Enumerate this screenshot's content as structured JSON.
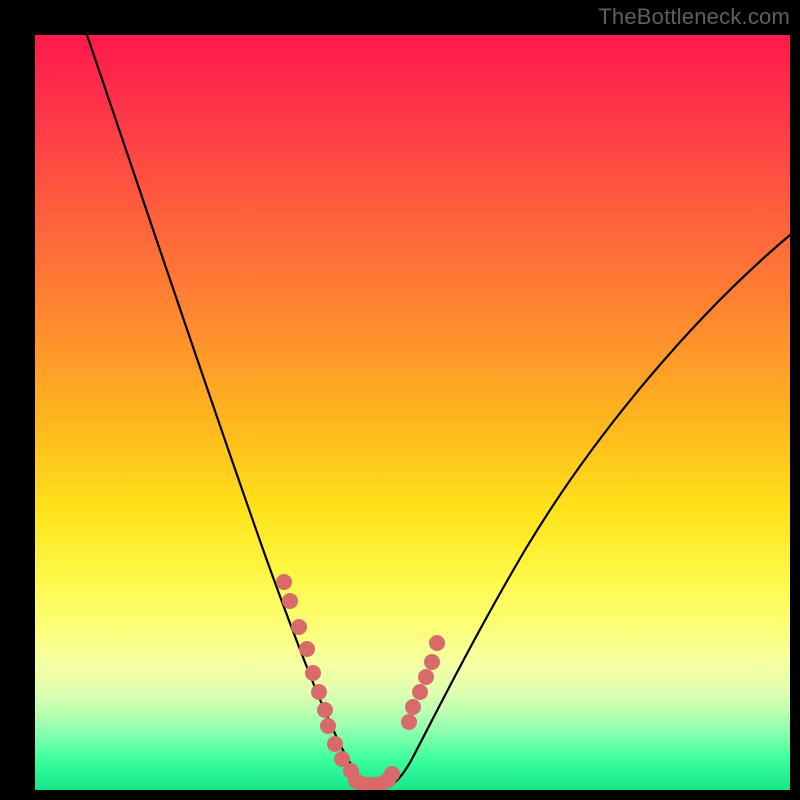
{
  "watermark": {
    "text": "TheBottleneck.com"
  },
  "colors": {
    "background": "#000000",
    "gradient_top": "#ff1a4b",
    "gradient_mid": "#ffe31a",
    "gradient_bottom": "#14e58c",
    "curve_stroke": "#000000",
    "marker_fill": "#d96a6a"
  },
  "chart_data": {
    "type": "line",
    "title": "",
    "xlabel": "",
    "ylabel": "",
    "xlim": [
      0,
      100
    ],
    "ylim": [
      0,
      100
    ],
    "grid": false,
    "legend": false,
    "annotations": [
      "TheBottleneck.com"
    ],
    "notes": "Bottleneck-style curve. y ≈ percent bottleneck (0 at minimum). x is an unlabeled independent axis. Curve read from pixels; values are approximate.",
    "series": [
      {
        "name": "curve",
        "x": [
          7,
          11,
          15,
          19,
          23,
          27,
          31,
          33,
          35,
          37,
          38,
          39,
          40,
          41,
          42,
          43,
          44,
          45,
          46,
          47,
          48,
          50,
          53,
          57,
          62,
          68,
          75,
          82,
          90,
          98
        ],
        "y": [
          100,
          89,
          78,
          67,
          56,
          45,
          34,
          28,
          22,
          16,
          12,
          9,
          6,
          3,
          1,
          0,
          0,
          0,
          1,
          3,
          6,
          11,
          18,
          27,
          37,
          47,
          56,
          63,
          69,
          74
        ]
      },
      {
        "name": "markers-left",
        "x": [
          33.0,
          33.8,
          35.0,
          36.0,
          36.8,
          37.6,
          38.4,
          38.8,
          39.8,
          40.6,
          41.8
        ],
        "y": [
          27.5,
          25.0,
          21.5,
          18.5,
          15.5,
          13.0,
          10.5,
          8.5,
          6.0,
          4.0,
          2.5
        ]
      },
      {
        "name": "markers-bottom",
        "x": [
          42.5,
          43.3,
          44.2,
          45.0,
          45.8,
          46.7,
          47.3
        ],
        "y": [
          1.2,
          0.8,
          0.6,
          0.6,
          0.8,
          1.3,
          2.2
        ]
      },
      {
        "name": "markers-right",
        "x": [
          49.5,
          50.1,
          51.0,
          51.8,
          52.6,
          53.3
        ],
        "y": [
          9.0,
          11.0,
          13.0,
          15.0,
          17.0,
          19.5
        ]
      }
    ]
  }
}
